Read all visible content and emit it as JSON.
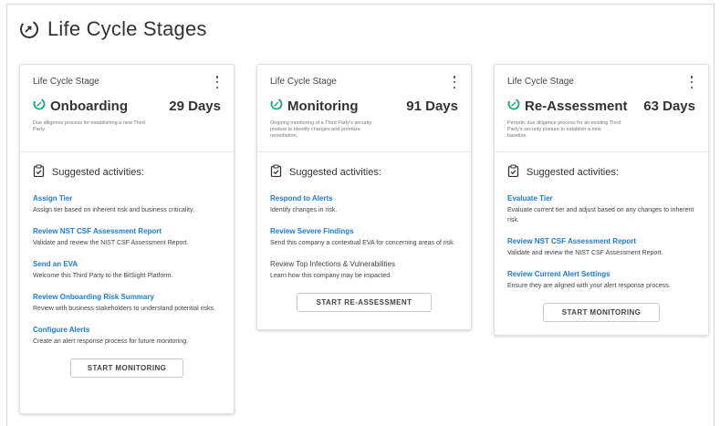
{
  "page": {
    "title": "Life Cycle Stages"
  },
  "colors": {
    "accent": "#1b7bd6",
    "teal": "#18a77a"
  },
  "cards": [
    {
      "stage_label": "Life Cycle Stage",
      "name": "Onboarding",
      "days": "29 Days",
      "description": "Due diligence process for establishing a new Third Party.",
      "suggested_label": "Suggested activities:",
      "activities": [
        {
          "title": "Assign Tier",
          "text": "Assign tier based on inherent risk and business criticality."
        },
        {
          "title": "Review NST CSF Assessment Report",
          "text": "Validate and review the NIST CSF Assessment Report."
        },
        {
          "title": "Send an EVA",
          "text": "Welcome this Third Party to the BitSight Platform."
        },
        {
          "title": "Review Onboarding Risk Summary",
          "text": "Review with business stakeholders to understand potential risks."
        },
        {
          "title": "Configure Alerts",
          "text": "Create an alert response process for future monitoring."
        }
      ],
      "button": "START MONITORING"
    },
    {
      "stage_label": "Life Cycle Stage",
      "name": "Monitoring",
      "days": "91 Days",
      "description": "Ongoing monitoring of a Third Party's security posture to identify changes and prioritize remediation.",
      "suggested_label": "Suggested activities:",
      "activities": [
        {
          "title": "Respond to Alerts",
          "text": "Identify changes in risk."
        },
        {
          "title": "Review Severe Findings",
          "text": "Send this company a contextual EVA for concerning areas of risk."
        },
        {
          "title": "Review Top Infections & Vulnerabilities",
          "text": "Learn how this company may be impacted."
        }
      ],
      "button": "START RE-ASSESSMENT"
    },
    {
      "stage_label": "Life Cycle Stage",
      "name": "Re-Assessment",
      "days": "63 Days",
      "description": "Periodic due diligence process for an existing Third Party's security posture to establish a new baseline.",
      "suggested_label": "Suggested activities:",
      "activities": [
        {
          "title": "Evaluate Tier",
          "text": "Evaluate current tier and adjust based on any changes to inherent risk."
        },
        {
          "title": "Review NST CSF Assessment Report",
          "text": "Validate and review the NIST CSF Assessment Report."
        },
        {
          "title": "Review Current Alert Settings",
          "text": "Ensure they are aligned with your alert response process."
        }
      ],
      "button": "START MONITORING"
    }
  ]
}
